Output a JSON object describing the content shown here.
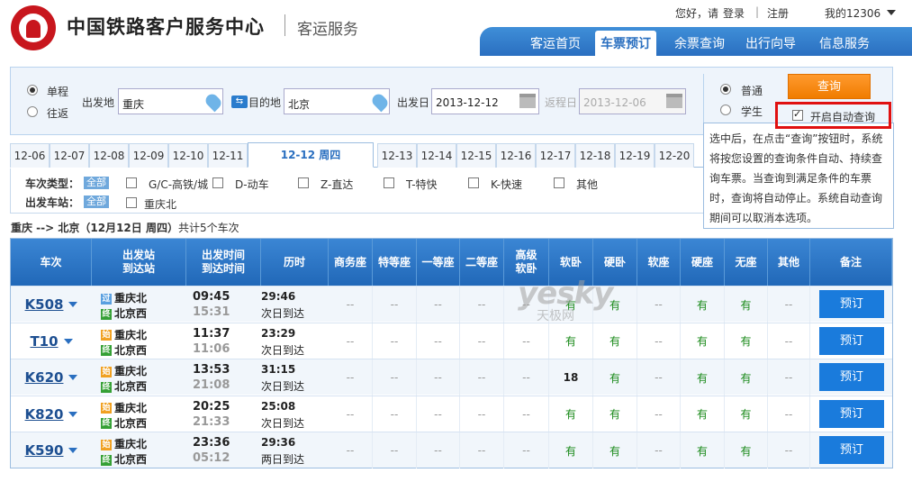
{
  "header": {
    "brand": "中国铁路客户服务中心",
    "section": "客运服务",
    "greeting": "您好，请",
    "login": "登录",
    "divider": "|",
    "register": "注册",
    "account": "我的12306"
  },
  "nav": [
    "客运首页",
    "车票预订",
    "余票查询",
    "出行向导",
    "信息服务"
  ],
  "search": {
    "trip_oneway": "单程",
    "trip_round": "往返",
    "from_label": "出发地",
    "from_value": "重庆",
    "to_label": "目的地",
    "to_value": "北京",
    "date_label": "出发日",
    "date_value": "2013-12-12",
    "return_label": "返程日",
    "return_value": "2013-12-06",
    "type_normal": "普通",
    "type_student": "学生",
    "query_button": "查询",
    "auto_query": "开启自动查询"
  },
  "tooltip": "选中后，在点击“查询”按钮时，系统将按您设置的查询条件自动、持续查询车票。当查询到满足条件的车票时，查询将自动停止。系统自动查询期间可以取消本选项。",
  "dates": [
    "12-06",
    "12-07",
    "12-08",
    "12-09",
    "12-10",
    "12-11",
    "12-12 周四",
    "12-13",
    "12-14",
    "12-15",
    "12-16",
    "12-17",
    "12-18",
    "12-19",
    "12-20"
  ],
  "filters": {
    "type_label": "车次类型：",
    "all": "全部",
    "types": [
      "G/C-高铁/城",
      "D-动车",
      "Z-直达",
      "T-特快",
      "K-快速",
      "其他"
    ],
    "station_label": "出发车站：",
    "stations": [
      "重庆北"
    ]
  },
  "summary": {
    "route": "重庆 --> 北京（12月12日 周四）",
    "count": "共计5个车次"
  },
  "table": {
    "headers": [
      "车次",
      "出发站\n到达站",
      "出发时间\n到达时间",
      "历时",
      "商务座",
      "特等座",
      "一等座",
      "二等座",
      "高级\n软卧",
      "软卧",
      "硬卧",
      "软座",
      "硬座",
      "无座",
      "其他",
      "备注"
    ],
    "book_label": "预订",
    "rows": [
      {
        "no": "K508",
        "from_tag": "过",
        "from": "重庆北",
        "to_tag": "终",
        "to": "北京西",
        "dep": "09:45",
        "arr": "15:31",
        "dur": "29:46",
        "day": "次日到达",
        "seats": [
          "--",
          "--",
          "--",
          "--",
          "--",
          "有",
          "有",
          "--",
          "有",
          "有",
          "--"
        ]
      },
      {
        "no": "T10",
        "from_tag": "始",
        "from": "重庆北",
        "to_tag": "终",
        "to": "北京西",
        "dep": "11:37",
        "arr": "11:06",
        "dur": "23:29",
        "day": "次日到达",
        "seats": [
          "--",
          "--",
          "--",
          "--",
          "--",
          "有",
          "有",
          "--",
          "有",
          "有",
          "--"
        ]
      },
      {
        "no": "K620",
        "from_tag": "始",
        "from": "重庆北",
        "to_tag": "终",
        "to": "北京西",
        "dep": "13:53",
        "arr": "21:08",
        "dur": "31:15",
        "day": "次日到达",
        "seats": [
          "--",
          "--",
          "--",
          "--",
          "--",
          "18",
          "有",
          "--",
          "有",
          "有",
          "--"
        ]
      },
      {
        "no": "K820",
        "from_tag": "始",
        "from": "重庆北",
        "to_tag": "终",
        "to": "北京西",
        "dep": "20:25",
        "arr": "21:33",
        "dur": "25:08",
        "day": "次日到达",
        "seats": [
          "--",
          "--",
          "--",
          "--",
          "--",
          "有",
          "有",
          "--",
          "有",
          "有",
          "--"
        ]
      },
      {
        "no": "K590",
        "from_tag": "始",
        "from": "重庆北",
        "to_tag": "终",
        "to": "北京西",
        "dep": "23:36",
        "arr": "05:12",
        "dur": "29:36",
        "day": "两日到达",
        "seats": [
          "--",
          "--",
          "--",
          "--",
          "--",
          "有",
          "有",
          "--",
          "有",
          "有",
          "--"
        ]
      }
    ]
  },
  "watermark": {
    "main": "yesky",
    "sub": "天极网"
  }
}
